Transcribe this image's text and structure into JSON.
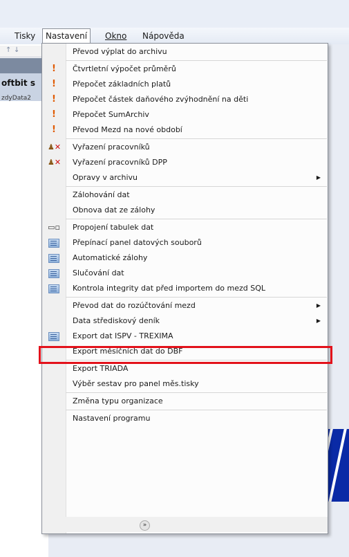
{
  "menubar": [
    {
      "label": "Tisky"
    },
    {
      "label": "Nastavení"
    },
    {
      "label": "Okno"
    },
    {
      "label": "Nápověda"
    }
  ],
  "background_fragments": {
    "title": "oftbit s",
    "subtitle": "zdyData2"
  },
  "menu": {
    "items": [
      {
        "label": "Převod výplat do archivu",
        "icon": "none"
      },
      {
        "label": "Čtvrtletní výpočet průměrů",
        "icon": "exclamation-icon"
      },
      {
        "label": "Přepočet základních platů",
        "icon": "exclamation-icon"
      },
      {
        "label": "Přepočet částek daňového zvýhodnění na děti",
        "icon": "exclamation-icon"
      },
      {
        "label": "Přepočet SumArchiv",
        "icon": "exclamation-icon"
      },
      {
        "label": "Převod Mezd na nové období",
        "icon": "exclamation-icon"
      },
      {
        "label": "Vyřazení pracovníků",
        "icon": "remove-person-icon"
      },
      {
        "label": "Vyřazení pracovníků DPP",
        "icon": "remove-person-icon"
      },
      {
        "label": "Opravy v archivu",
        "icon": "none",
        "submenu": true
      },
      {
        "label": "Zálohování dat",
        "icon": "none"
      },
      {
        "label": "Obnova dat ze zálohy",
        "icon": "none"
      },
      {
        "label": "Propojení tabulek dat",
        "icon": "link-tables-icon"
      },
      {
        "label": "Přepínací panel datových souborů",
        "icon": "database-icon"
      },
      {
        "label": "Automatické zálohy",
        "icon": "database-icon"
      },
      {
        "label": "Slučování dat",
        "icon": "database-icon"
      },
      {
        "label": "Kontrola integrity dat před importem do mezd SQL",
        "icon": "database-icon",
        "highlighted": true
      },
      {
        "label": "Převod dat do rozúčtování mezd",
        "icon": "none",
        "submenu": true
      },
      {
        "label": "Data střediskový deník",
        "icon": "none",
        "submenu": true
      },
      {
        "label": "Export dat ISPV - TREXIMA",
        "icon": "database-icon"
      },
      {
        "label": "Export měsíčních dat do DBF",
        "icon": "none"
      },
      {
        "label": "Export TRIADA",
        "icon": "none"
      },
      {
        "label": "Výběr sestav pro panel měs.tisky",
        "icon": "none"
      },
      {
        "label": "Změna typu organizace",
        "icon": "none"
      },
      {
        "label": "Nastavení programu",
        "icon": "none"
      }
    ],
    "footer_icon": "expand-more-icon"
  },
  "colors": {
    "highlight_border": "#e3121b",
    "exclamation": "#e05a00",
    "remove_x": "#d01010",
    "blue_area": "#0a2aa6"
  }
}
